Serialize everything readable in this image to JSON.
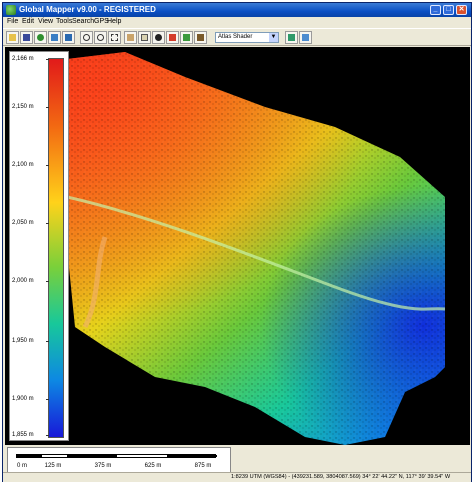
{
  "window": {
    "title": "Global Mapper v9.00 - REGISTERED",
    "controls": {
      "minimize": "_",
      "maximize": "□",
      "close": "✕"
    }
  },
  "menu": {
    "items": [
      "File",
      "Edit",
      "View",
      "Tools",
      "Search",
      "GPS",
      "Help"
    ]
  },
  "toolbar": {
    "shader_select": {
      "value": "Atlas Shader"
    },
    "buttons": [
      "open-icon",
      "save-icon",
      "globe-icon",
      "config-icon",
      "pointer-icon",
      "zoom-in-icon",
      "zoom-out-icon",
      "select-icon",
      "pan-icon",
      "measure-icon",
      "info-icon",
      "digitizer-icon",
      "path-profile-icon",
      "3d-view-icon",
      "terrain-icon",
      "chart-icon"
    ]
  },
  "legend": {
    "ticks": [
      "2,166 m",
      "2,150 m",
      "2,100 m",
      "2,050 m",
      "2,000 m",
      "1,950 m",
      "1,900 m",
      "1,855 m"
    ],
    "colors": {
      "top": "#e11a1a",
      "mid": "#ffd21a",
      "low": "#18c89a",
      "bottom": "#1818d8"
    }
  },
  "scalebar": {
    "labels": [
      "0 m",
      "125 m",
      "375 m",
      "625 m",
      "875 m"
    ]
  },
  "status": {
    "coords": "1:8239    UTM (WGS84) - (439231.589, 3804087.569)    34° 22' 44.22\" N, 117° 39' 39.54\" W"
  }
}
